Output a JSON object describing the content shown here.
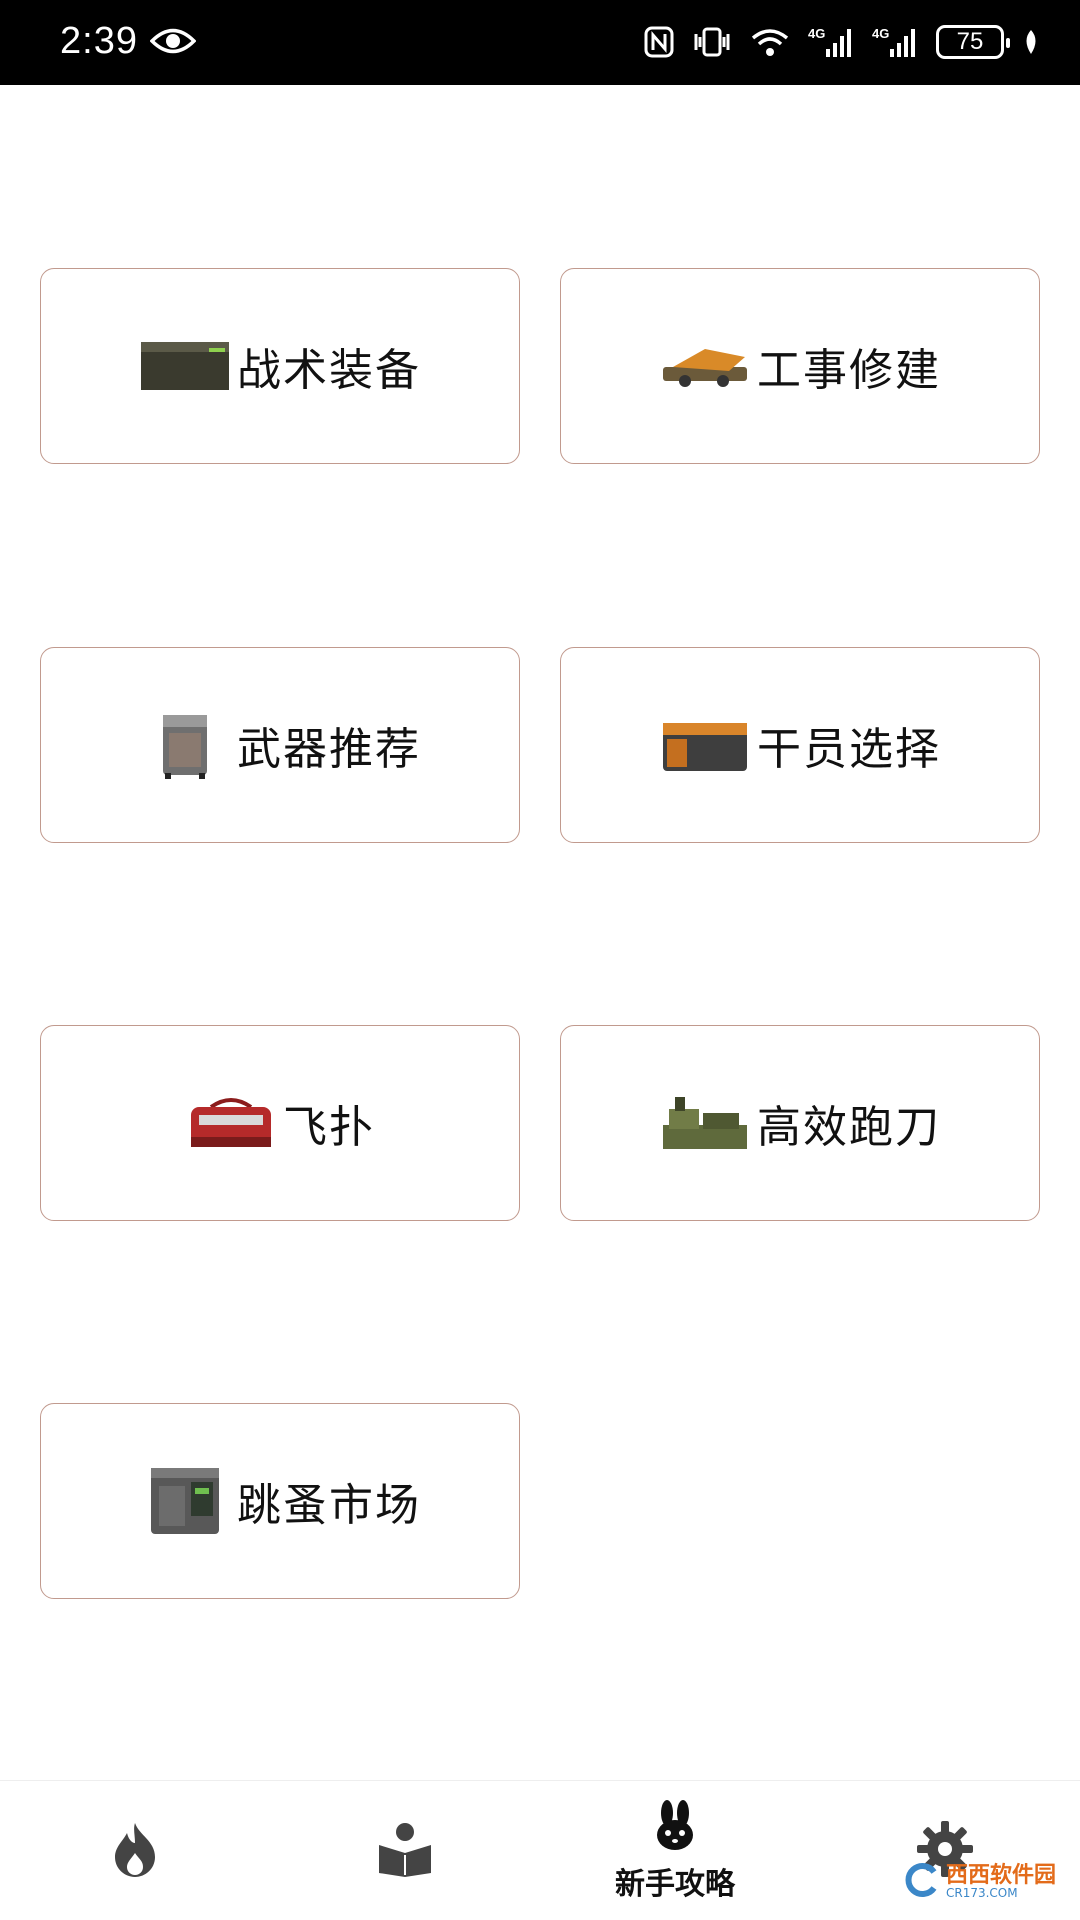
{
  "status_bar": {
    "time": "2:39",
    "battery": "75",
    "icons": [
      "eye-icon",
      "nfc-icon",
      "vibrate-icon",
      "wifi-icon",
      "signal-4g-icon",
      "signal-4g-icon",
      "battery-icon",
      "leaf-icon"
    ]
  },
  "menu": {
    "items": [
      {
        "label": "战术装备",
        "icon": "equipment-box-icon"
      },
      {
        "label": "工事修建",
        "icon": "construction-icon"
      },
      {
        "label": "武器推荐",
        "icon": "weapon-case-icon"
      },
      {
        "label": "干员选择",
        "icon": "operator-crate-icon"
      },
      {
        "label": "飞扑",
        "icon": "red-bag-icon"
      },
      {
        "label": "高效跑刀",
        "icon": "supply-pile-icon"
      },
      {
        "label": "跳蚤市场",
        "icon": "market-cabinet-icon"
      }
    ]
  },
  "bottom_nav": {
    "items": [
      {
        "name": "hot",
        "icon": "flame-icon",
        "label": ""
      },
      {
        "name": "guide",
        "icon": "reader-icon",
        "label": ""
      },
      {
        "name": "beginner",
        "icon": "rabbit-icon",
        "label": "新手攻略",
        "active": true
      },
      {
        "name": "settings",
        "icon": "gear-icon",
        "label": ""
      }
    ]
  },
  "watermark": {
    "text": "西西软件园",
    "sub": "CR173.COM"
  },
  "colors": {
    "card_border": "#c19a8e",
    "status_bar": "#000000",
    "nav_icon": "#444444"
  }
}
